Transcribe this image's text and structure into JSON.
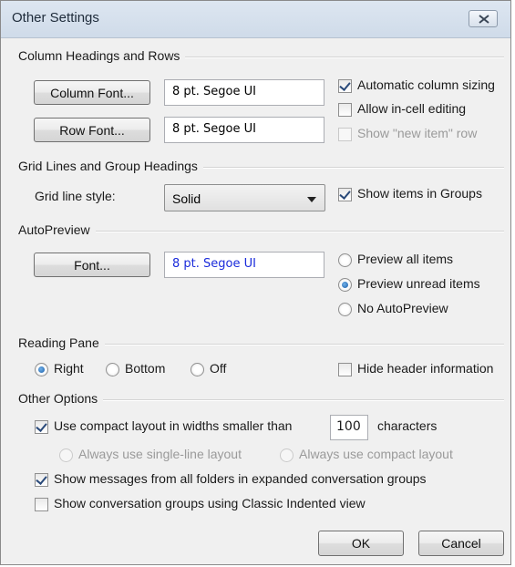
{
  "window": {
    "title": "Other Settings"
  },
  "icons": {
    "close": "close-icon"
  },
  "column_headings": {
    "title": "Column Headings and Rows",
    "column_font_button": "Column Font...",
    "column_font_value": "8 pt. Segoe UI",
    "row_font_button": "Row Font...",
    "row_font_value": "8 pt. Segoe UI",
    "automatic_column_sizing": {
      "label": "Automatic column sizing",
      "checked": true
    },
    "allow_in_cell_editing": {
      "label": "Allow in-cell editing",
      "checked": false
    },
    "show_new_item_row": {
      "label": "Show \"new item\" row",
      "checked": false,
      "disabled": true
    }
  },
  "grid_lines": {
    "title": "Grid Lines and Group Headings",
    "style_label": "Grid line style:",
    "style_value": "Solid",
    "show_items_in_groups": {
      "label": "Show items in Groups",
      "checked": true
    }
  },
  "autopreview": {
    "title": "AutoPreview",
    "font_button": "Font...",
    "font_value": "8 pt. Segoe UI",
    "options": [
      {
        "label": "Preview all items",
        "selected": false
      },
      {
        "label": "Preview unread items",
        "selected": true
      },
      {
        "label": "No AutoPreview",
        "selected": false
      }
    ]
  },
  "reading_pane": {
    "title": "Reading Pane",
    "options": [
      {
        "label": "Right",
        "selected": true
      },
      {
        "label": "Bottom",
        "selected": false
      },
      {
        "label": "Off",
        "selected": false
      }
    ],
    "hide_header_information": {
      "label": "Hide header information",
      "checked": false
    }
  },
  "other_options": {
    "title": "Other Options",
    "compact_layout": {
      "label": "Use compact layout in widths smaller than",
      "checked": true,
      "value": "100",
      "suffix": "characters"
    },
    "single_line_layout": {
      "label": "Always use single-line layout",
      "disabled": true
    },
    "always_compact_layout": {
      "label": "Always use compact layout",
      "disabled": true
    },
    "show_messages_all_folders": {
      "label": "Show messages from all folders in expanded conversation groups",
      "checked": true
    },
    "classic_indented": {
      "label": "Show conversation groups using Classic Indented view",
      "checked": false
    }
  },
  "footer": {
    "ok_label": "OK",
    "cancel_label": "Cancel"
  },
  "colors": {
    "autopreview_font_text": "#1a2bdb",
    "window_background": "#f0f0f0",
    "title_bar": "#d6e1ee"
  }
}
